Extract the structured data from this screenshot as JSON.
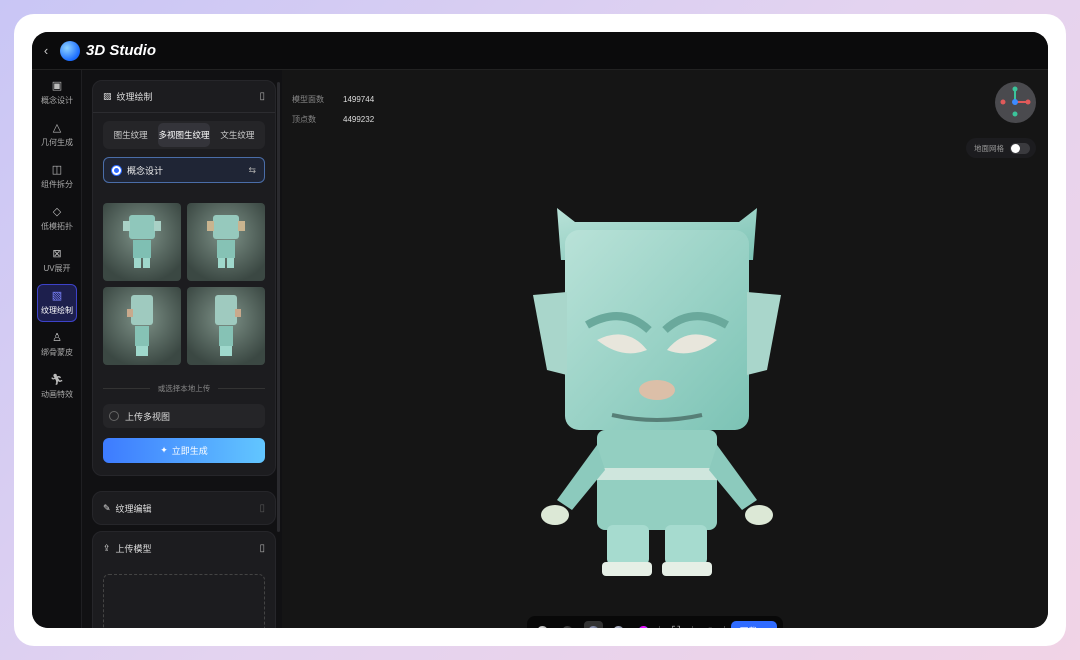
{
  "app": {
    "title": "3D Studio"
  },
  "sidebar": {
    "items": [
      {
        "label": "概念设计",
        "icon": "image-icon"
      },
      {
        "label": "几何生成",
        "icon": "shapes-icon"
      },
      {
        "label": "组件拆分",
        "icon": "split-icon"
      },
      {
        "label": "低模拓扑",
        "icon": "mesh-icon"
      },
      {
        "label": "UV展开",
        "icon": "uv-icon"
      },
      {
        "label": "纹理绘制",
        "icon": "texture-icon",
        "active": true
      },
      {
        "label": "绑骨蒙皮",
        "icon": "skeleton-icon"
      },
      {
        "label": "动画特效",
        "icon": "run-icon"
      }
    ]
  },
  "texture_panel": {
    "title": "纹理绘制",
    "tabs": [
      "图生纹理",
      "多视图生纹理",
      "文生纹理"
    ],
    "active_tab": 1,
    "source": "概念设计",
    "divider": "或选择本地上传",
    "upload_label": "上传多视图",
    "generate_label": "立即生成"
  },
  "edit_panel": {
    "title": "纹理编辑"
  },
  "upload_panel": {
    "title": "上传模型"
  },
  "viewport": {
    "stats": [
      {
        "label": "模型面数",
        "value": "1499744"
      },
      {
        "label": "顶点数",
        "value": "4499232"
      }
    ],
    "ground_grid_label": "地面网格",
    "ground_grid_on": false,
    "download_label": "下载"
  },
  "colors": {
    "accent": "#2f6bff",
    "active_nav": "#1d1f4d"
  }
}
